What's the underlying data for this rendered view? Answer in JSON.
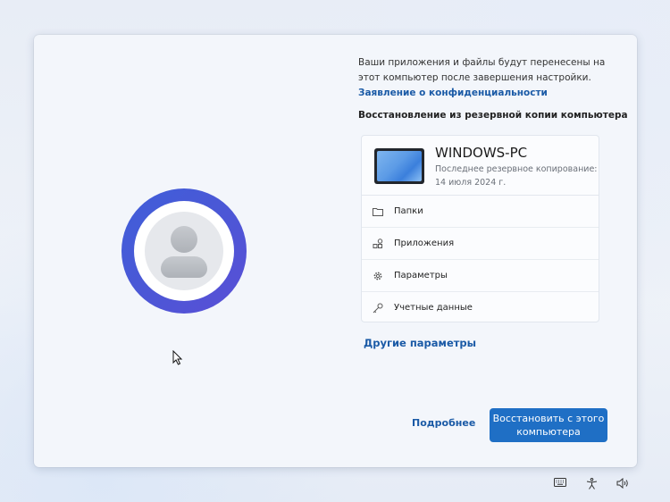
{
  "intro": {
    "text": "Ваши приложения и файлы будут перенесены на этот компьютер после завершения настройки.",
    "link": "Заявление о конфиденциальности"
  },
  "section_title": "Восстановление из резервной копии компьютера",
  "device": {
    "name": "WINDOWS-PC",
    "backup_label": "Последнее резервное копирование:",
    "backup_date": "14 июля 2024 г."
  },
  "items": [
    {
      "label": "Папки",
      "icon": "folder-icon"
    },
    {
      "label": "Приложения",
      "icon": "apps-icon"
    },
    {
      "label": "Параметры",
      "icon": "gear-icon"
    },
    {
      "label": "Учетные данные",
      "icon": "key-icon"
    }
  ],
  "links": {
    "other_options": "Другие параметры"
  },
  "buttons": {
    "learn_more": "Подробнее",
    "restore": "Восстановить с этого компьютера"
  },
  "tray": [
    "keyboard-icon",
    "accessibility-icon",
    "volume-icon"
  ],
  "colors": {
    "accent": "#1f6fc5",
    "link": "#1a5aa6",
    "avatar_ring": "#4b57d6"
  }
}
